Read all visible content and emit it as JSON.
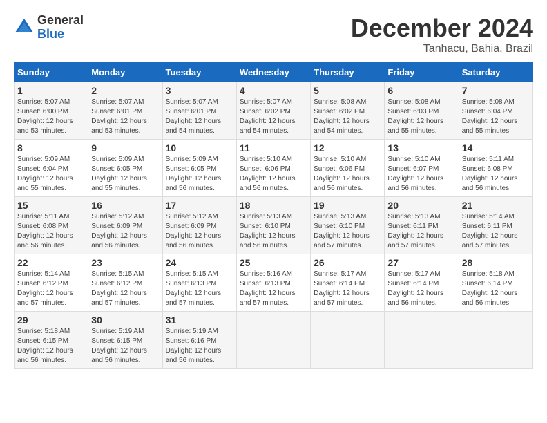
{
  "logo": {
    "general": "General",
    "blue": "Blue"
  },
  "title": "December 2024",
  "location": "Tanhacu, Bahia, Brazil",
  "days_of_week": [
    "Sunday",
    "Monday",
    "Tuesday",
    "Wednesday",
    "Thursday",
    "Friday",
    "Saturday"
  ],
  "weeks": [
    [
      {
        "day": "1",
        "info": "Sunrise: 5:07 AM\nSunset: 6:00 PM\nDaylight: 12 hours and 53 minutes."
      },
      {
        "day": "2",
        "info": "Sunrise: 5:07 AM\nSunset: 6:01 PM\nDaylight: 12 hours and 53 minutes."
      },
      {
        "day": "3",
        "info": "Sunrise: 5:07 AM\nSunset: 6:01 PM\nDaylight: 12 hours and 54 minutes."
      },
      {
        "day": "4",
        "info": "Sunrise: 5:07 AM\nSunset: 6:02 PM\nDaylight: 12 hours and 54 minutes."
      },
      {
        "day": "5",
        "info": "Sunrise: 5:08 AM\nSunset: 6:02 PM\nDaylight: 12 hours and 54 minutes."
      },
      {
        "day": "6",
        "info": "Sunrise: 5:08 AM\nSunset: 6:03 PM\nDaylight: 12 hours and 55 minutes."
      },
      {
        "day": "7",
        "info": "Sunrise: 5:08 AM\nSunset: 6:04 PM\nDaylight: 12 hours and 55 minutes."
      }
    ],
    [
      {
        "day": "8",
        "info": "Sunrise: 5:09 AM\nSunset: 6:04 PM\nDaylight: 12 hours and 55 minutes."
      },
      {
        "day": "9",
        "info": "Sunrise: 5:09 AM\nSunset: 6:05 PM\nDaylight: 12 hours and 55 minutes."
      },
      {
        "day": "10",
        "info": "Sunrise: 5:09 AM\nSunset: 6:05 PM\nDaylight: 12 hours and 56 minutes."
      },
      {
        "day": "11",
        "info": "Sunrise: 5:10 AM\nSunset: 6:06 PM\nDaylight: 12 hours and 56 minutes."
      },
      {
        "day": "12",
        "info": "Sunrise: 5:10 AM\nSunset: 6:06 PM\nDaylight: 12 hours and 56 minutes."
      },
      {
        "day": "13",
        "info": "Sunrise: 5:10 AM\nSunset: 6:07 PM\nDaylight: 12 hours and 56 minutes."
      },
      {
        "day": "14",
        "info": "Sunrise: 5:11 AM\nSunset: 6:08 PM\nDaylight: 12 hours and 56 minutes."
      }
    ],
    [
      {
        "day": "15",
        "info": "Sunrise: 5:11 AM\nSunset: 6:08 PM\nDaylight: 12 hours and 56 minutes."
      },
      {
        "day": "16",
        "info": "Sunrise: 5:12 AM\nSunset: 6:09 PM\nDaylight: 12 hours and 56 minutes."
      },
      {
        "day": "17",
        "info": "Sunrise: 5:12 AM\nSunset: 6:09 PM\nDaylight: 12 hours and 56 minutes."
      },
      {
        "day": "18",
        "info": "Sunrise: 5:13 AM\nSunset: 6:10 PM\nDaylight: 12 hours and 56 minutes."
      },
      {
        "day": "19",
        "info": "Sunrise: 5:13 AM\nSunset: 6:10 PM\nDaylight: 12 hours and 57 minutes."
      },
      {
        "day": "20",
        "info": "Sunrise: 5:13 AM\nSunset: 6:11 PM\nDaylight: 12 hours and 57 minutes."
      },
      {
        "day": "21",
        "info": "Sunrise: 5:14 AM\nSunset: 6:11 PM\nDaylight: 12 hours and 57 minutes."
      }
    ],
    [
      {
        "day": "22",
        "info": "Sunrise: 5:14 AM\nSunset: 6:12 PM\nDaylight: 12 hours and 57 minutes."
      },
      {
        "day": "23",
        "info": "Sunrise: 5:15 AM\nSunset: 6:12 PM\nDaylight: 12 hours and 57 minutes."
      },
      {
        "day": "24",
        "info": "Sunrise: 5:15 AM\nSunset: 6:13 PM\nDaylight: 12 hours and 57 minutes."
      },
      {
        "day": "25",
        "info": "Sunrise: 5:16 AM\nSunset: 6:13 PM\nDaylight: 12 hours and 57 minutes."
      },
      {
        "day": "26",
        "info": "Sunrise: 5:17 AM\nSunset: 6:14 PM\nDaylight: 12 hours and 57 minutes."
      },
      {
        "day": "27",
        "info": "Sunrise: 5:17 AM\nSunset: 6:14 PM\nDaylight: 12 hours and 56 minutes."
      },
      {
        "day": "28",
        "info": "Sunrise: 5:18 AM\nSunset: 6:14 PM\nDaylight: 12 hours and 56 minutes."
      }
    ],
    [
      {
        "day": "29",
        "info": "Sunrise: 5:18 AM\nSunset: 6:15 PM\nDaylight: 12 hours and 56 minutes."
      },
      {
        "day": "30",
        "info": "Sunrise: 5:19 AM\nSunset: 6:15 PM\nDaylight: 12 hours and 56 minutes."
      },
      {
        "day": "31",
        "info": "Sunrise: 5:19 AM\nSunset: 6:16 PM\nDaylight: 12 hours and 56 minutes."
      },
      {
        "day": "",
        "info": ""
      },
      {
        "day": "",
        "info": ""
      },
      {
        "day": "",
        "info": ""
      },
      {
        "day": "",
        "info": ""
      }
    ]
  ]
}
